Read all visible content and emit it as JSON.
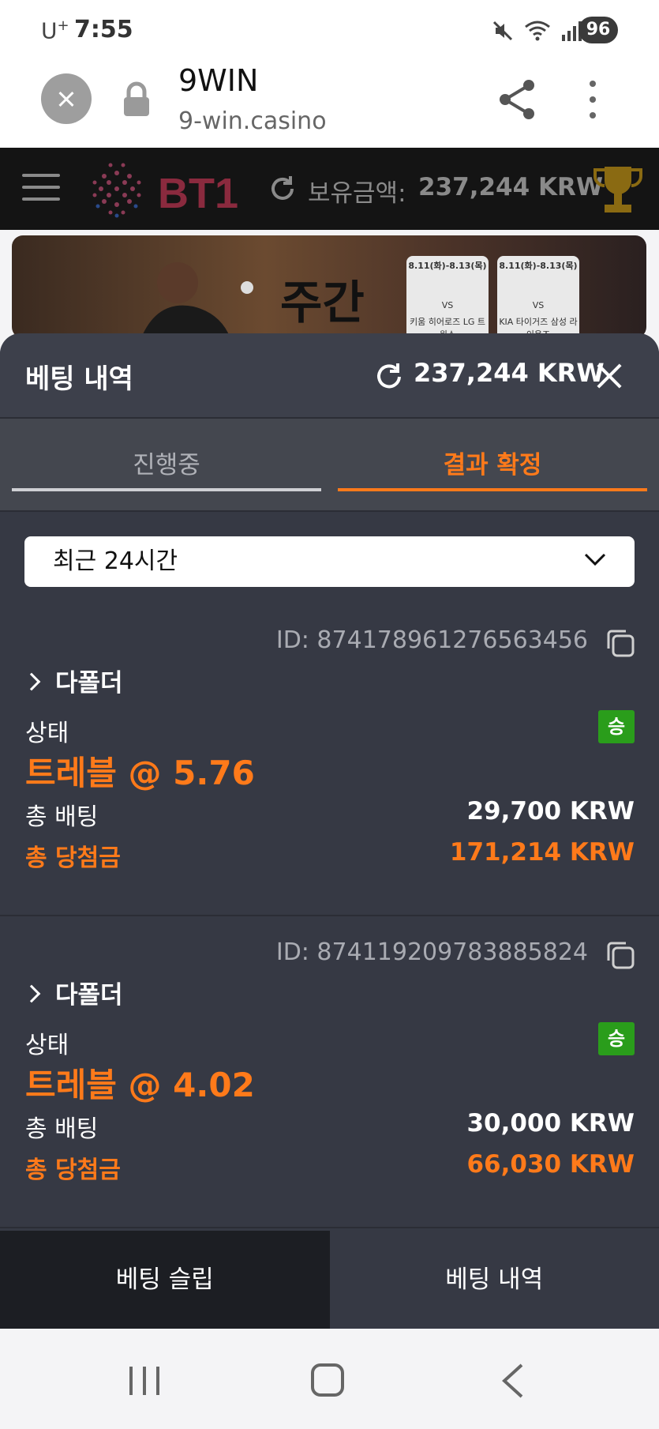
{
  "status_bar": {
    "carrier": "U",
    "carrier_sup": "+",
    "time": "7:55",
    "battery": "96"
  },
  "browser": {
    "title": "9WIN",
    "url": "9-win.casino"
  },
  "site_header": {
    "logo_text": "BT1",
    "balance_label": "보유금액:",
    "balance_value": "237,244 KRW"
  },
  "banner": {
    "headline": "주간",
    "cards": [
      {
        "dates": "8.11(화)-8.13(목)",
        "team1": "키움 히어로즈",
        "vs": "VS",
        "team2": "LG 트윈스"
      },
      {
        "dates": "8.11(화)-8.13(목)",
        "team1": "KIA 타이거즈",
        "vs": "VS",
        "team2": "삼성 라이온즈"
      }
    ]
  },
  "sheet": {
    "title": "베팅 내역",
    "balance": "237,244 KRW",
    "tabs": [
      {
        "label": "진행중",
        "active": false
      },
      {
        "label": "결과 확정",
        "active": true
      }
    ],
    "filter": {
      "selected": "최근 24시간"
    },
    "bets": [
      {
        "id": "ID: 874178961276563456",
        "type": "다폴더",
        "status_label": "상태",
        "result_badge": "승",
        "odds_text": "트레블 @ 5.76",
        "total_bet_label": "총 배팅",
        "total_bet_value": "29,700 KRW",
        "total_win_label": "총 당첨금",
        "total_win_value": "171,214 KRW"
      },
      {
        "id": "ID: 874119209783885824",
        "type": "다폴더",
        "status_label": "상태",
        "result_badge": "승",
        "odds_text": "트레블 @ 4.02",
        "total_bet_label": "총 배팅",
        "total_bet_value": "30,000 KRW",
        "total_win_label": "총 당첨금",
        "total_win_value": "66,030 KRW"
      }
    ]
  },
  "bottom_bar": {
    "left": "베팅 슬립",
    "right": "베팅 내역"
  },
  "colors": {
    "accent": "#ff7a1a",
    "win_badge": "#2a9d1b",
    "sheet_bg": "#363944"
  }
}
